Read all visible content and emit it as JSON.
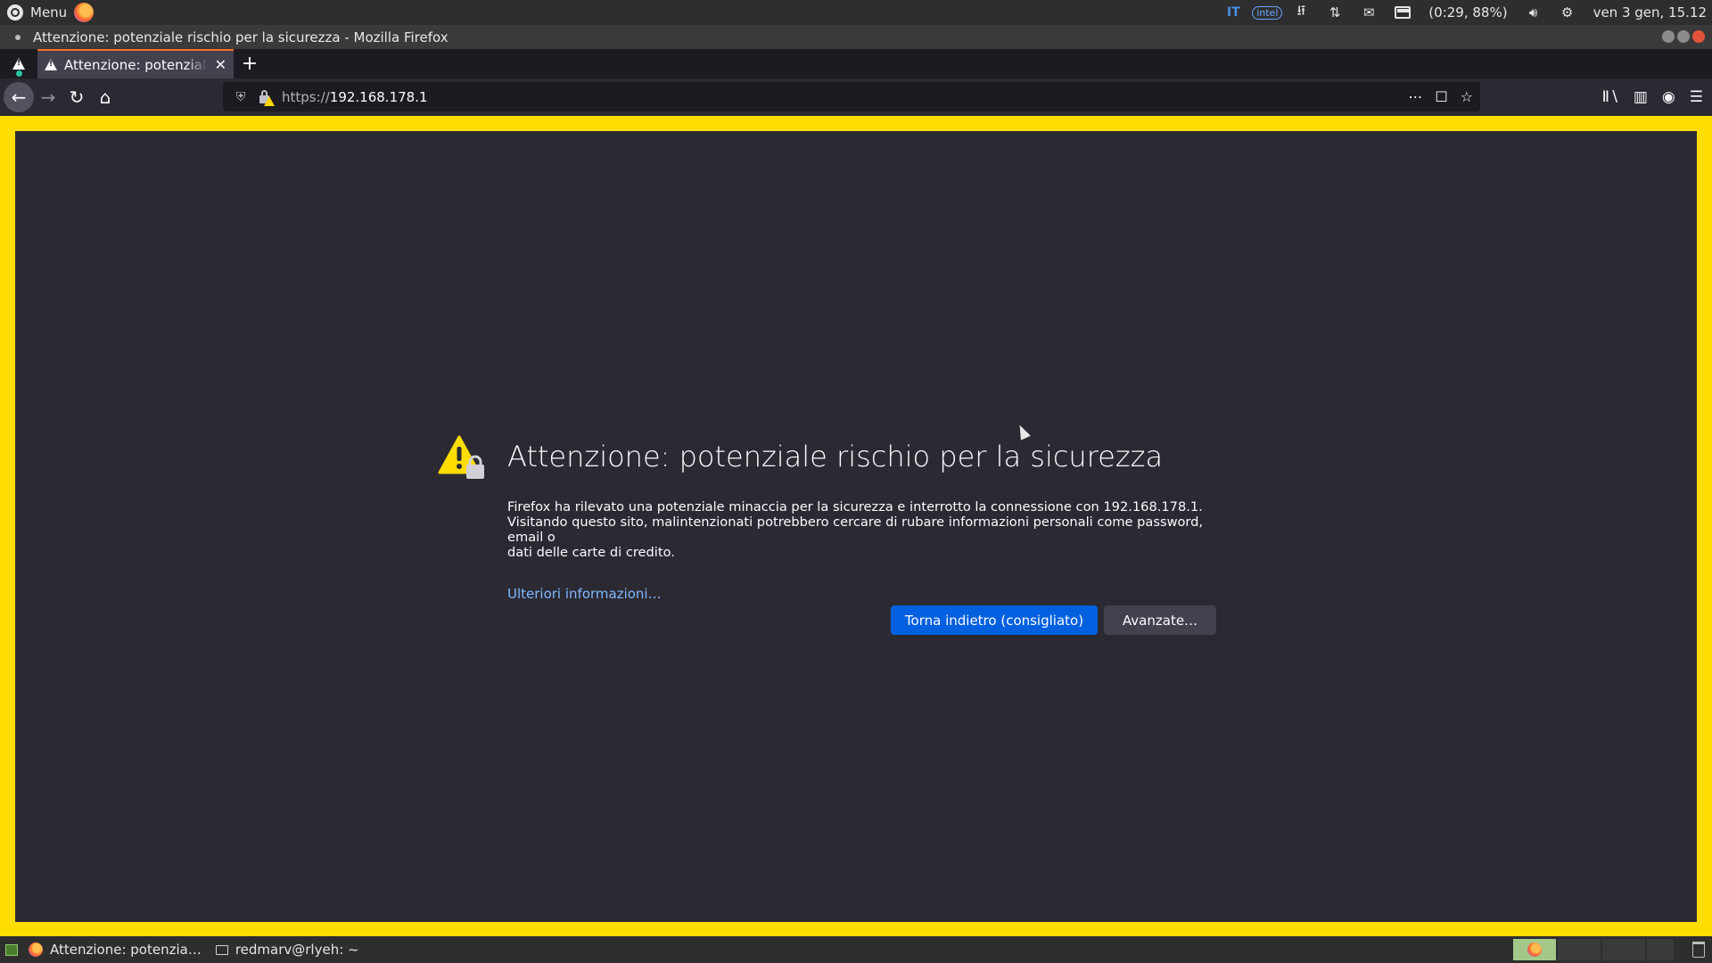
{
  "top_panel": {
    "menu_label": "Menu",
    "keyboard_layout": "IT",
    "gpu_label": "intel",
    "battery_text": "(0:29, 88%)",
    "datetime": "ven 3 gen, 15.12"
  },
  "window": {
    "title": "Attenzione: potenziale rischio per la sicurezza - Mozilla Firefox"
  },
  "tabs": [
    {
      "label": "Attenzione: potenziale rischio per la sicurezza",
      "active": true
    }
  ],
  "navbar": {
    "url_scheme": "https://",
    "url_host": "192.168.178.1"
  },
  "error_page": {
    "title": "Attenzione: potenziale rischio per la sicurezza",
    "description_lines": [
      "Firefox ha rilevato una potenziale minaccia per la sicurezza e interrotto la connessione con 192.168.178.1.",
      "Visitando questo sito, malintenzionati potrebbero cercare di rubare informazioni personali come password, email o",
      "dati delle carte di credito."
    ],
    "learn_more": "Ulteriori informazioni…",
    "primary_button": "Torna indietro (consigliato)",
    "advanced_button": "Avanzate…",
    "accent_color": "#0060df",
    "warning_border_color": "#ffdd00"
  },
  "taskbar": {
    "items": [
      {
        "label": "Attenzione: potenzia…",
        "icon": "firefox-icon"
      },
      {
        "label": "redmarv@rlyeh: ~",
        "icon": "terminal-icon"
      }
    ]
  }
}
